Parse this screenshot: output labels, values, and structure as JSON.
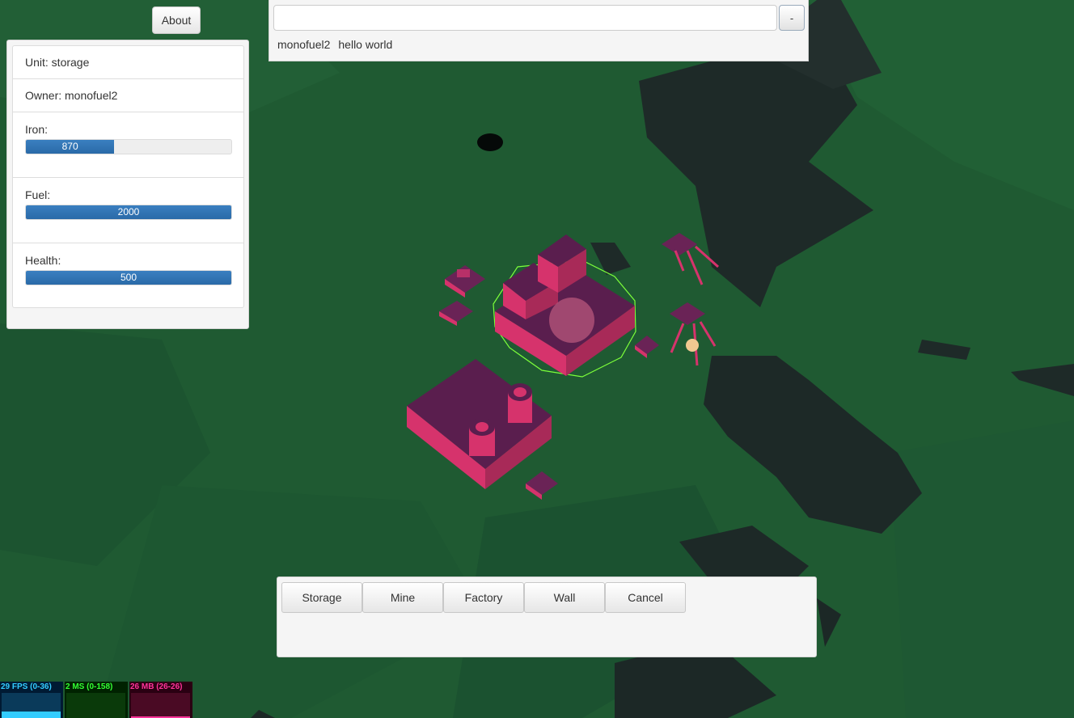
{
  "about": {
    "label": "About"
  },
  "unit_panel": {
    "unit": "Unit: storage",
    "owner": "Owner: monofuel2",
    "resources": [
      {
        "label": "Iron:",
        "value": "870",
        "fraction": 0.43
      },
      {
        "label": "Fuel:",
        "value": "2000",
        "fraction": 1.0
      },
      {
        "label": "Health:",
        "value": "500",
        "fraction": 1.0
      }
    ]
  },
  "chat": {
    "input_value": "",
    "toggle_label": "-",
    "messages": [
      {
        "user": "monofuel2",
        "text": "hello world"
      }
    ]
  },
  "actions": [
    "Storage",
    "Mine",
    "Factory",
    "Wall",
    "Cancel"
  ],
  "stats": [
    {
      "label": "29 FPS (0-36)",
      "color": "#33ccff",
      "bg": "#001a33"
    },
    {
      "label": "2 MS (0-158)",
      "color": "#33ff33",
      "bg": "#002200"
    },
    {
      "label": "26 MB (26-26)",
      "color": "#ff3399",
      "bg": "#2a0012"
    }
  ],
  "colors": {
    "ground": "#1f5a32",
    "unit": "#d6336c",
    "selection": "#7cff3a"
  }
}
